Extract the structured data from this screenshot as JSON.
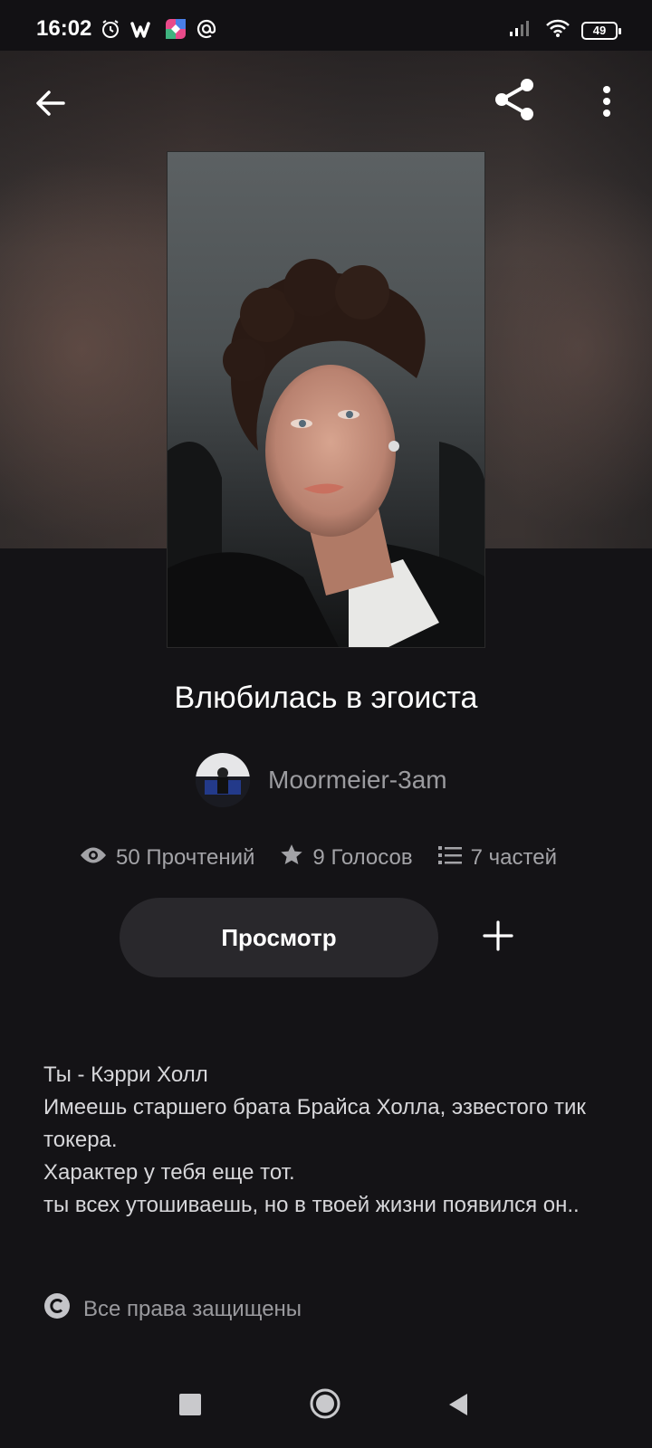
{
  "status_bar": {
    "time": "16:02",
    "battery": "49",
    "icons": [
      "alarm-icon",
      "wattpad-icon",
      "app-icon",
      "at-icon",
      "signal-icon",
      "wifi-icon",
      "battery-icon"
    ]
  },
  "top_bar": {
    "icons": [
      "back-arrow-icon",
      "share-icon",
      "more-vertical-icon"
    ]
  },
  "book": {
    "title": "Влюбилась в эгоиста",
    "author": "Moormeier-3am",
    "stats": {
      "reads": "50 Прочтений",
      "votes": "9 Голосов",
      "parts": "7 частей"
    },
    "read_button": "Просмотр",
    "description": [
      "Ты - Кэрри Холл",
      "Имеешь старшего брата Брайса Холла, эзвестого тик токера.",
      "Характер у тебя еще тот.",
      "ты всех утошиваешь, но в твоей жизни появился он.."
    ],
    "copyright": "Все права защищены"
  },
  "colors": {
    "background": "#141316",
    "button_bg": "#29282c",
    "muted_text": "#9b9b9f"
  }
}
